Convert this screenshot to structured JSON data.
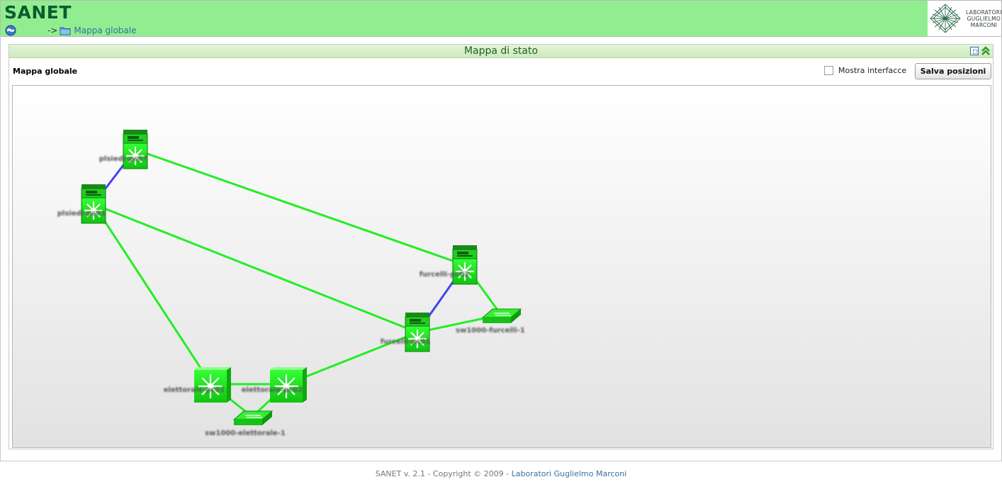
{
  "header": {
    "title": "SANET",
    "breadcrumb": {
      "separator": "->",
      "current": "Mappa globale"
    },
    "logo": {
      "line1": "LABORATORI",
      "line2": "GUGLIELMO",
      "line3": "MARCONI"
    }
  },
  "panel": {
    "title": "Mappa di stato",
    "map_name": "Mappa globale",
    "show_interfaces_label": "Mostra interfacce",
    "show_interfaces_checked": false,
    "save_button": "Salva posizioni"
  },
  "map": {
    "nodes": [
      {
        "id": "n1",
        "type": "router",
        "label": "plsiedi-pc07"
      },
      {
        "id": "n2",
        "type": "router",
        "label": "plsiedi-pc01"
      },
      {
        "id": "n3",
        "type": "router",
        "label": "furcelli-pc02"
      },
      {
        "id": "n4",
        "type": "router",
        "label": "furcelli-pc01"
      },
      {
        "id": "n5",
        "type": "l3switch",
        "label": "elettorale-pc01"
      },
      {
        "id": "n6",
        "type": "l3switch",
        "label": "elettorale-pc02"
      },
      {
        "id": "n7",
        "type": "switch",
        "label": "sw1000-furcelli-1"
      },
      {
        "id": "n8",
        "type": "switch",
        "label": "sw1000-elettorale-1"
      }
    ],
    "links": [
      {
        "from": "n1",
        "to": "n2",
        "color": "#4444ee"
      },
      {
        "from": "n1",
        "to": "n3",
        "color": "#22ee22"
      },
      {
        "from": "n2",
        "to": "n4",
        "color": "#22ee22"
      },
      {
        "from": "n2",
        "to": "n5",
        "color": "#22ee22"
      },
      {
        "from": "n3",
        "to": "n4",
        "color": "#4444ee"
      },
      {
        "from": "n3",
        "to": "n7",
        "color": "#22ee22"
      },
      {
        "from": "n4",
        "to": "n7",
        "color": "#22ee22"
      },
      {
        "from": "n4",
        "to": "n6",
        "color": "#22ee22"
      },
      {
        "from": "n5",
        "to": "n6",
        "color": "#22ee22"
      },
      {
        "from": "n5",
        "to": "n8",
        "color": "#22ee22"
      },
      {
        "from": "n6",
        "to": "n8",
        "color": "#22ee22"
      }
    ],
    "status_color": "#22dd22"
  },
  "footer": {
    "text": "SANET v. 2.1 - Copyright © 2009 -",
    "link": "Laboratori Guglielmo Marconi"
  }
}
